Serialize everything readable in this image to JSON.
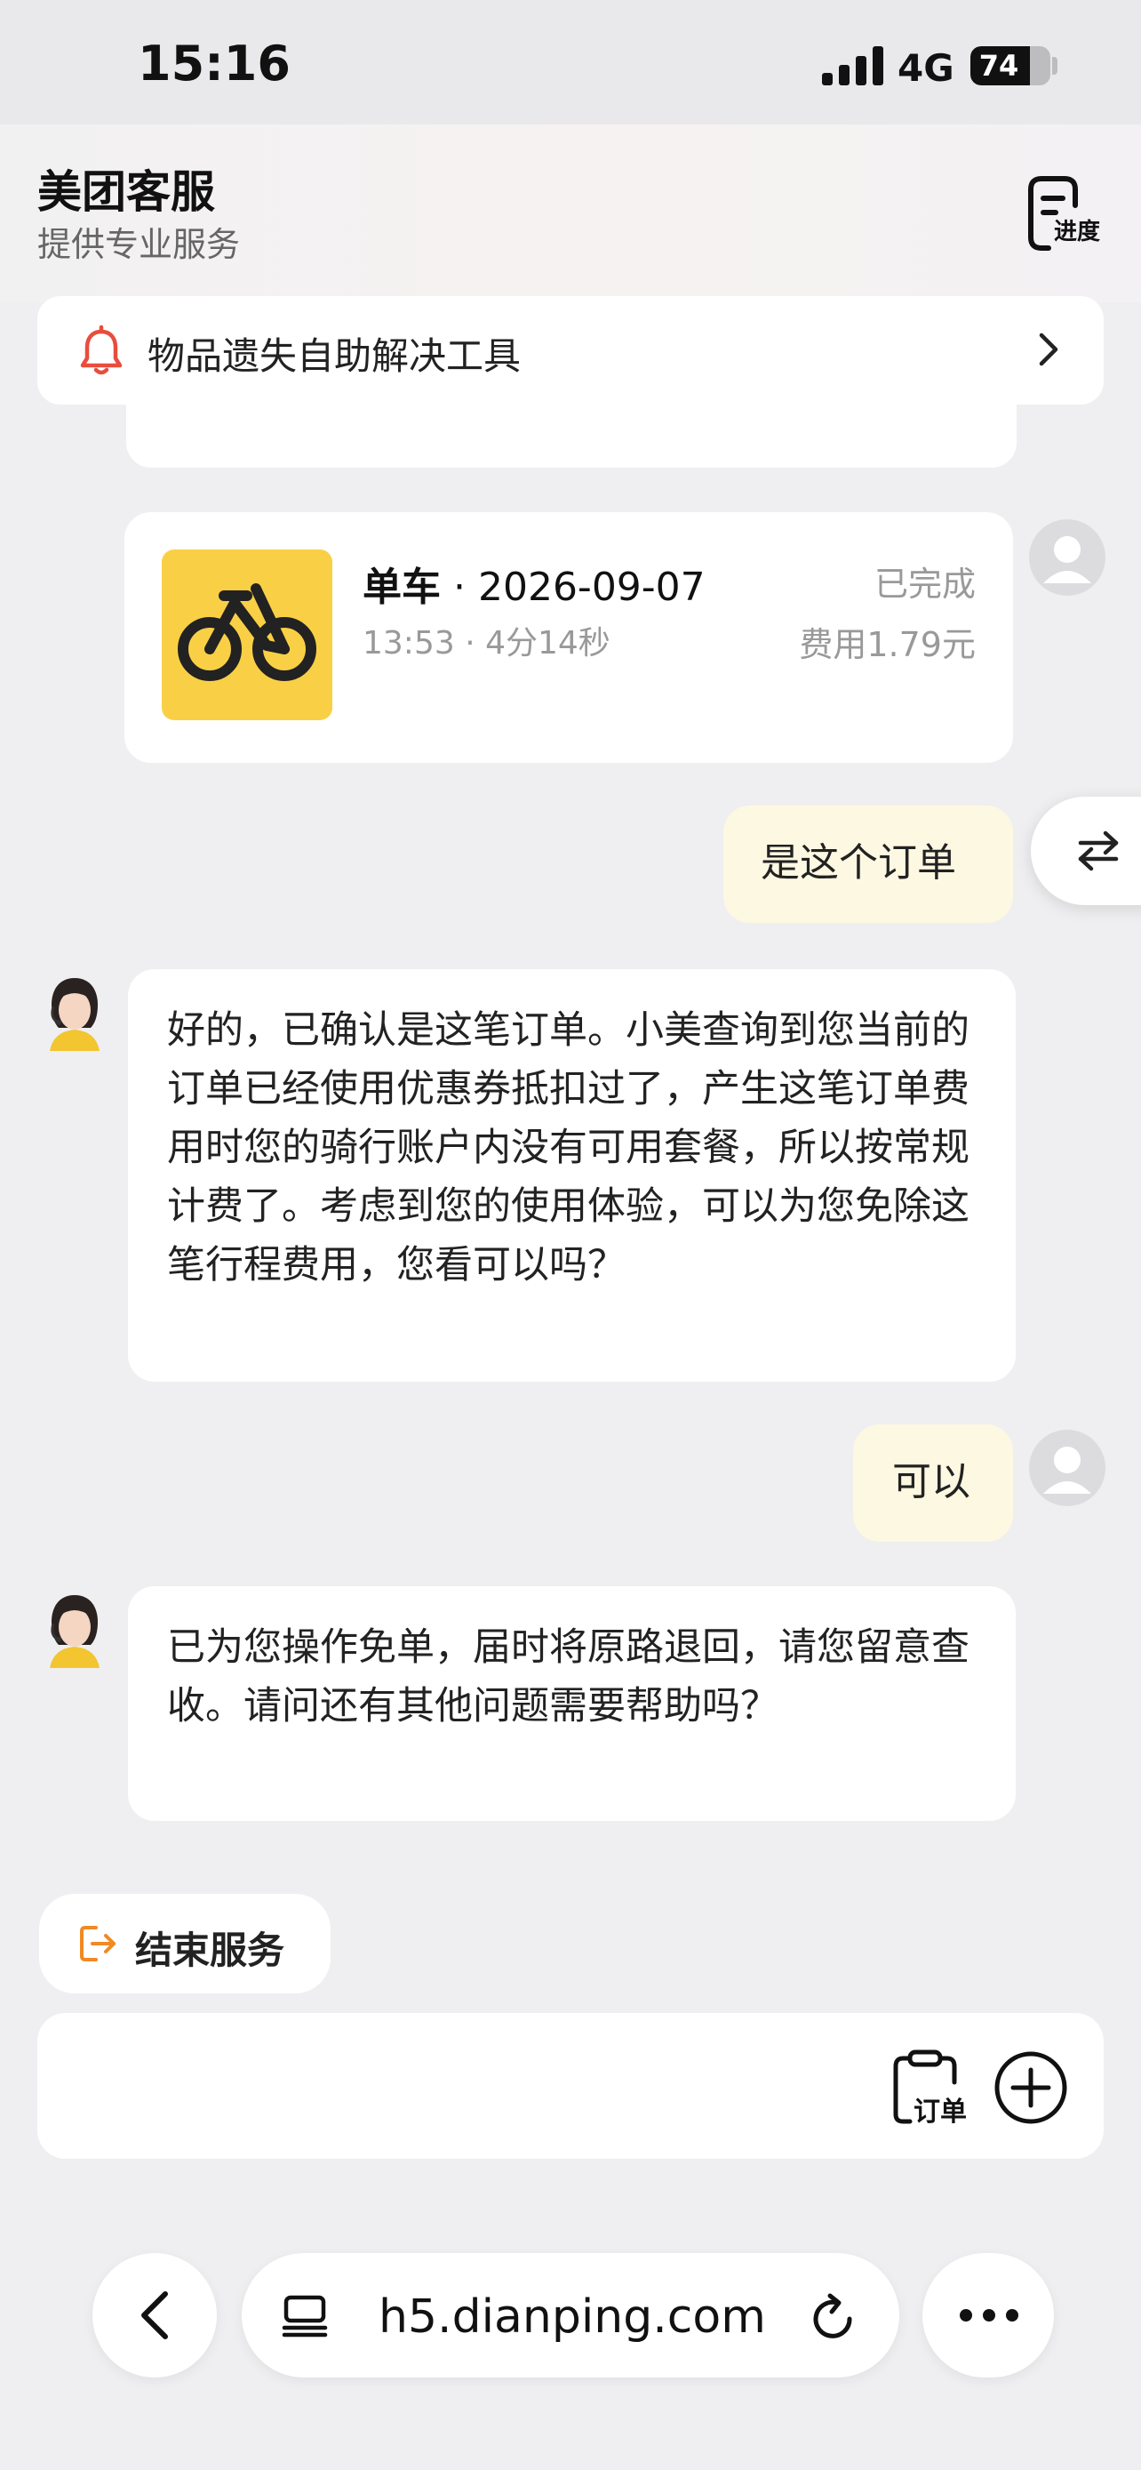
{
  "status_bar": {
    "time": "15:16",
    "network": "4G",
    "battery": "74",
    "battery_level": 0.74
  },
  "header": {
    "title": "美团客服",
    "subtitle": "提供专业服务",
    "progress_label": "进度"
  },
  "notice": {
    "text": "物品遗失自助解决工具"
  },
  "order_card": {
    "title_main": "单车",
    "title_date": " · 2026-09-07",
    "meta": "13:53 · 4分14秒",
    "status": "已完成",
    "fee": "费用1.79元"
  },
  "messages": [
    {
      "from": "user",
      "text": "是这个订单"
    },
    {
      "from": "agent",
      "text": "好的，已确认是这笔订单。小美查询到您当前的订单已经使用优惠券抵扣过了，产生这笔订单费用时您的骑行账户内没有可用套餐，所以按常规计费了。考虑到您的使用体验，可以为您免除这笔行程费用，您看可以吗？"
    },
    {
      "from": "user",
      "text": "可以"
    },
    {
      "from": "agent",
      "text": "已为您操作免单，届时将原路退回，请您留意查收。请问还有其他问题需要帮助吗？"
    }
  ],
  "end_service": {
    "label": "结束服务"
  },
  "input_bar": {
    "order_label": "订单"
  },
  "browser": {
    "url": "h5.dianping.com"
  },
  "colors": {
    "accent_orange": "#f08a24",
    "bell_red": "#e84d3d",
    "user_bubble": "#fdf8e1",
    "bike_yellow": "#f9d045"
  }
}
